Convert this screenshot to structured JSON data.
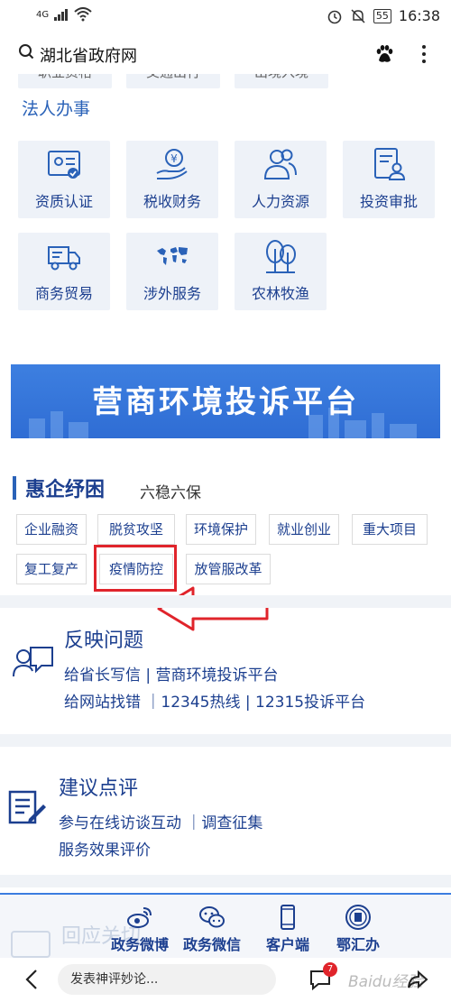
{
  "status_bar": {
    "network": "4G",
    "battery": "55",
    "time": "16:38"
  },
  "search_bar": {
    "title": "湖北省政府网"
  },
  "partial_row": [
    "职业资格",
    "交通出行",
    "出境入境"
  ],
  "legal_affairs": {
    "title": "法人办事",
    "tiles": [
      {
        "label": "资质认证",
        "icon": "certificate-icon"
      },
      {
        "label": "税收财务",
        "icon": "tax-coin-hand-icon"
      },
      {
        "label": "人力资源",
        "icon": "people-icon"
      },
      {
        "label": "投资审批",
        "icon": "document-user-icon"
      },
      {
        "label": "商务贸易",
        "icon": "delivery-truck-icon"
      },
      {
        "label": "涉外服务",
        "icon": "world-map-icon"
      },
      {
        "label": "农林牧渔",
        "icon": "tree-icon"
      }
    ]
  },
  "banner": {
    "text": "营商环境投诉平台"
  },
  "huiqi": {
    "title": "惠企纾困",
    "subtitle": "六稳六保",
    "tags_row1": [
      "企业融资",
      "脱贫攻坚",
      "环境保护",
      "就业创业",
      "重大项目"
    ],
    "tags_row2": [
      "复工复产",
      "疫情防控",
      "放管服改革"
    ]
  },
  "feedback": {
    "title": "反映问题",
    "line1": "给省长写信 | 营商环境投诉平台",
    "line2": "给网站找错 ｜12345热线 | 12315投诉平台"
  },
  "suggest": {
    "title": "建议点评",
    "line1": "参与在线访谈互动 ｜调查征集",
    "line2": "服务效果评价"
  },
  "footer": {
    "ghost_text": "回应关切",
    "items": [
      {
        "label": "政务微博",
        "icon": "weibo-icon"
      },
      {
        "label": "政务微信",
        "icon": "wechat-icon"
      },
      {
        "label": "客户端",
        "icon": "phone-icon"
      },
      {
        "label": "鄂汇办",
        "icon": "ehuiban-logo-icon"
      }
    ]
  },
  "bottom_bar": {
    "comment_placeholder": "发表神评妙论...",
    "badge_count": "7",
    "watermark": "Baidu经验"
  },
  "colors": {
    "primary_text": "#1c3f8f",
    "accent_blue": "#2a62b8",
    "tile_bg": "#eef2f8",
    "highlight_red": "#e0242b"
  }
}
